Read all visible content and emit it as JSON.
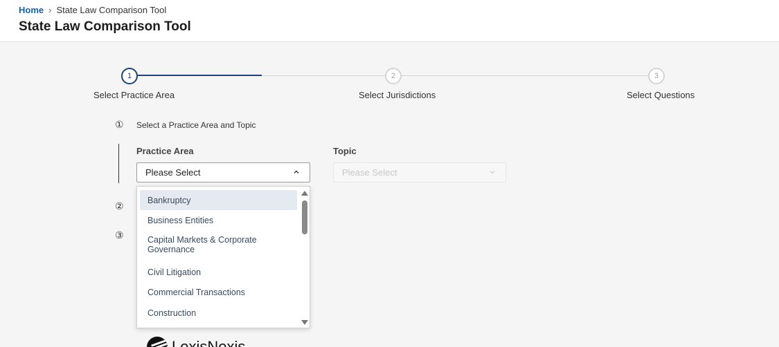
{
  "breadcrumb": {
    "home": "Home",
    "separator": "›",
    "current": "State Law Comparison Tool"
  },
  "page_title": "State Law Comparison Tool",
  "stepper": {
    "steps": [
      {
        "number": "1",
        "label": "Select Practice Area",
        "state": "active"
      },
      {
        "number": "2",
        "label": "Select Jurisdictions",
        "state": "inactive"
      },
      {
        "number": "3",
        "label": "Select Questions",
        "state": "inactive"
      }
    ]
  },
  "questions": {
    "q1": {
      "number": "①",
      "text": "Select a Practice Area and Topic"
    },
    "q2": {
      "number": "②"
    },
    "q3": {
      "number": "③"
    }
  },
  "practice_area": {
    "label": "Practice Area",
    "value": "Please Select",
    "expanded": true,
    "options": [
      "Bankruptcy",
      "Business Entities",
      "Capital Markets & Corporate Governance",
      "Civil Litigation",
      "Commercial Transactions",
      "Construction"
    ],
    "highlighted_option": "Bankruptcy"
  },
  "topic": {
    "label": "Topic",
    "value": "Please Select",
    "disabled": true
  },
  "footer": {
    "logo_text": "LexisNexis"
  },
  "colors": {
    "link": "#1a5ea8",
    "step_active": "#1f3f7a",
    "step_inactive": "#d4d4d4",
    "select_border": "#6aa8d8",
    "highlight": "#e5eaf0"
  }
}
